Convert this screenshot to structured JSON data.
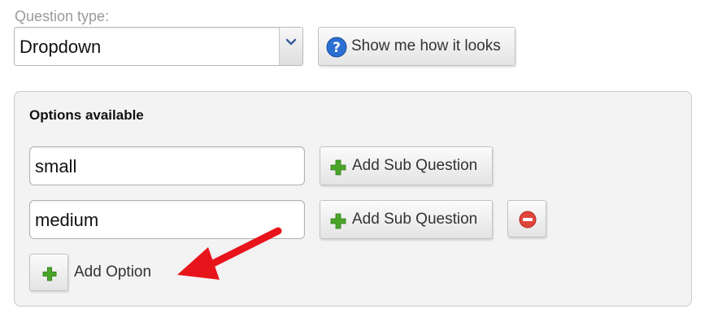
{
  "question_type": {
    "label": "Question type:",
    "selected": "Dropdown",
    "show_button_label": "Show me how it looks"
  },
  "options_panel": {
    "title": "Options available",
    "options": [
      {
        "value": "small",
        "sub_button_label": "Add Sub Question"
      },
      {
        "value": "medium",
        "sub_button_label": "Add Sub Question"
      }
    ],
    "add_option_label": "Add Option"
  },
  "colors": {
    "plus_green": "#4aa42a",
    "remove_red": "#e0453a",
    "help_blue": "#2b6fd1",
    "annotation_arrow": "#e8141c"
  },
  "icons": [
    "chevron-down-icon",
    "help-icon",
    "plus-icon",
    "minus-circle-icon",
    "annotation-arrow"
  ]
}
